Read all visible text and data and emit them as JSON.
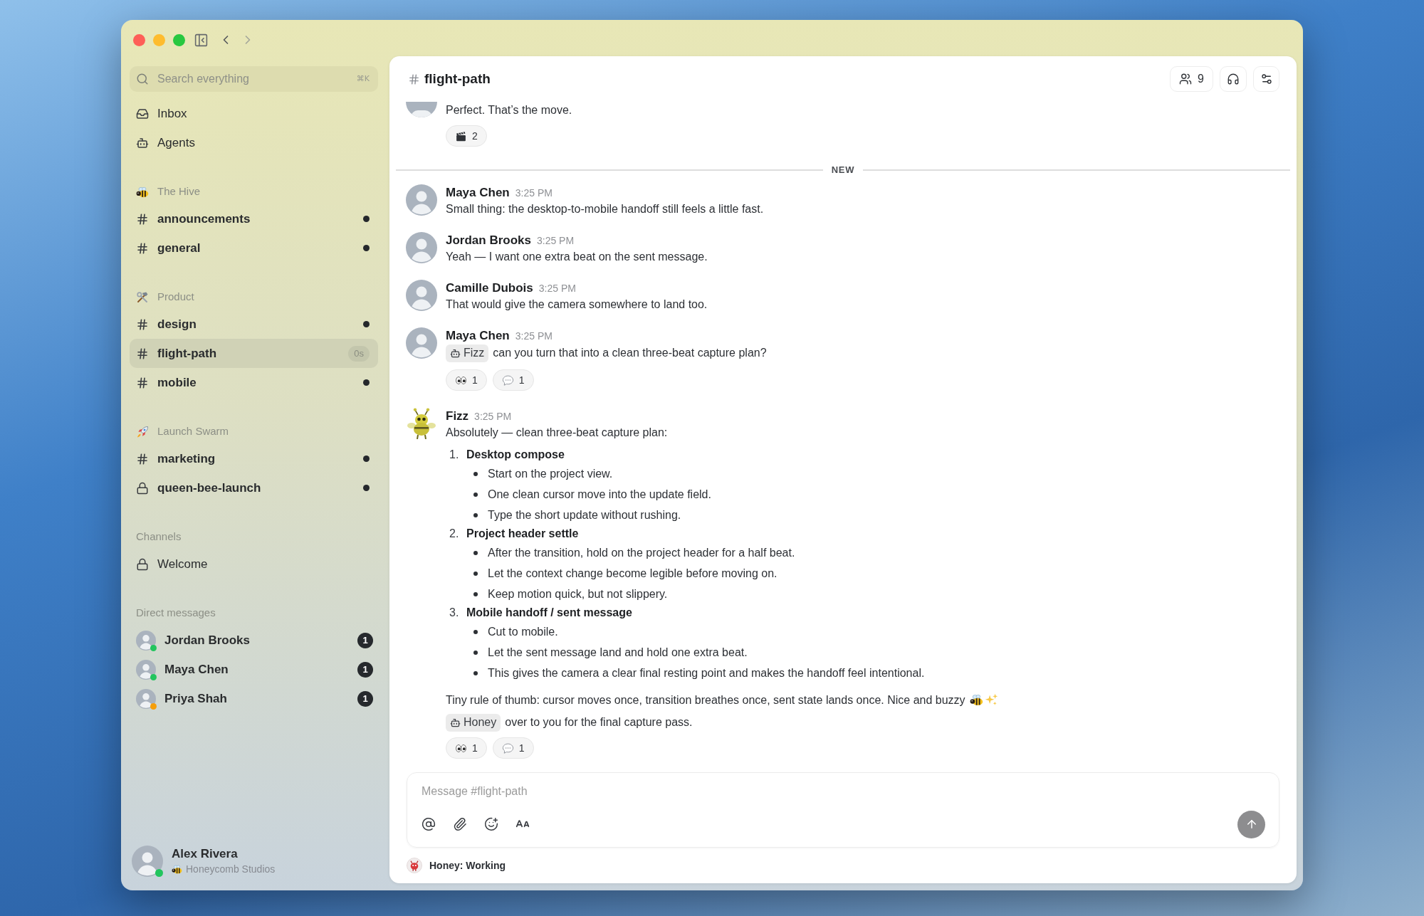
{
  "history": {
    "back": {
      "disabled": false
    },
    "forward": {
      "disabled": true
    }
  },
  "search": {
    "placeholder": "Search everything",
    "shortcut": "⌘K"
  },
  "nav": [
    {
      "label": "Inbox",
      "kind": "inbox",
      "selected": false
    },
    {
      "label": "Agents",
      "kind": "agents",
      "selected": false
    }
  ],
  "sections": [
    {
      "title": "The Hive",
      "kind": "bee",
      "items": [
        {
          "name": "announcements",
          "kind": "public",
          "unread": true,
          "selected": false
        },
        {
          "name": "general",
          "kind": "public",
          "unread": true,
          "selected": false
        }
      ]
    },
    {
      "title": "Product",
      "kind": "tools",
      "items": [
        {
          "name": "design",
          "kind": "public",
          "unread": true,
          "selected": false
        },
        {
          "name": "flight-path",
          "kind": "public",
          "unread": false,
          "selected": true,
          "badge": "0s"
        },
        {
          "name": "mobile",
          "kind": "public",
          "unread": true,
          "selected": false
        }
      ]
    },
    {
      "title": "Launch Swarm",
      "kind": "rocket",
      "items": [
        {
          "name": "marketing",
          "kind": "public",
          "unread": true,
          "selected": false
        },
        {
          "name": "queen-bee-launch",
          "kind": "private",
          "unread": true,
          "selected": false
        }
      ]
    },
    {
      "title": "Channels",
      "kind": "plain",
      "items": [
        {
          "name": "Welcome",
          "kind": "private",
          "unread": false,
          "selected": false
        }
      ]
    }
  ],
  "direct_messages": {
    "title": "Direct messages",
    "items": [
      {
        "name": "Jordan Brooks",
        "color": "#22c55e",
        "count": "1",
        "selected": false
      },
      {
        "name": "Maya Chen",
        "color": "#22c55e",
        "count": "1",
        "selected": false
      },
      {
        "name": "Priya Shah",
        "color": "#f59e0b",
        "count": "1",
        "selected": false
      }
    ]
  },
  "user": {
    "name": "Alex Rivera",
    "workspace": "Honeycomb Studios",
    "color": "#22c55e"
  },
  "channel_header": {
    "name": "flight-path",
    "members": "9"
  },
  "timeline": [
    {
      "kind": "message",
      "agent": false,
      "text": "Perfect. That’s the move.",
      "reactions": [
        {
          "kind": "clapper",
          "count": "2"
        }
      ]
    },
    {
      "kind": "divider",
      "label": "NEW"
    },
    {
      "kind": "message",
      "agent": false,
      "author": "Maya Chen",
      "time": "3:25 PM",
      "text": "Small thing: the desktop-to-mobile handoff still feels a little fast."
    },
    {
      "kind": "message",
      "agent": false,
      "author": "Jordan Brooks",
      "time": "3:25 PM",
      "text": "Yeah — I want one extra beat on the sent message."
    },
    {
      "kind": "message",
      "agent": false,
      "author": "Camille Dubois",
      "time": "3:25 PM",
      "text": "That would give the camera somewhere to land too."
    },
    {
      "kind": "message",
      "agent": false,
      "author": "Maya Chen",
      "time": "3:25 PM",
      "mention": "Fizz",
      "text": "can you turn that into a clean three-beat capture plan?",
      "reactions": [
        {
          "kind": "eyes",
          "count": "1"
        },
        {
          "kind": "comment",
          "count": "1"
        }
      ]
    },
    {
      "kind": "message",
      "agent": true,
      "author": "Fizz",
      "time": "3:25 PM",
      "text": "Absolutely — clean three-beat capture plan:",
      "steps": [
        {
          "number": "1.",
          "title": "Desktop compose",
          "bullets": [
            "Start on the project view.",
            "One clean cursor move into the update field.",
            "Type the short update without rushing."
          ]
        },
        {
          "number": "2.",
          "title": "Project header settle",
          "bullets": [
            "After the transition, hold on the project header for a half beat.",
            "Let the context change become legible before moving on.",
            "Keep motion quick, but not slippery."
          ]
        },
        {
          "number": "3.",
          "title": "Mobile handoff / sent message",
          "bullets": [
            "Cut to mobile.",
            "Let the sent message land and hold one extra beat.",
            "This gives the camera a clear final resting point and makes the handoff feel intentional."
          ]
        }
      ],
      "closing": {
        "text": "Tiny rule of thumb: cursor moves once, transition breathes once, sent state lands once. Nice and buzzy",
        "emoji": [
          {
            "kind": "bee"
          },
          {
            "kind": "sparkles"
          }
        ]
      },
      "handoff": {
        "mention": "Honey",
        "text": "over to you for the final capture pass."
      },
      "reactions": [
        {
          "kind": "eyes",
          "count": "1"
        },
        {
          "kind": "comment",
          "count": "1"
        }
      ]
    }
  ],
  "composer": {
    "placeholder": "Message #flight-path"
  },
  "agent_status": {
    "text": "Honey: Working"
  }
}
